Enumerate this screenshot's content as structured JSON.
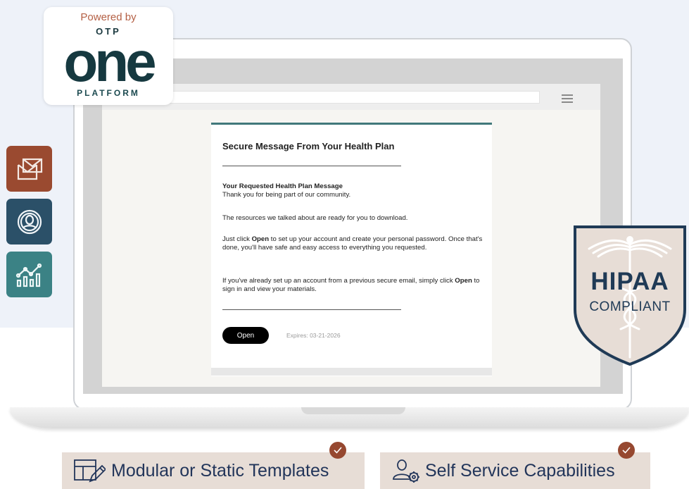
{
  "logo": {
    "powered_by": "Powered by",
    "brand_top": "OTP",
    "brand_main": "one",
    "brand_bottom": "PLATFORM",
    "colors": {
      "accent": "#b46045",
      "dark": "#163940"
    }
  },
  "side_icons": [
    {
      "name": "envelope-icon",
      "color": "#9a4a30"
    },
    {
      "name": "user-circle-icon",
      "color": "#2b5068"
    },
    {
      "name": "analytics-chart-icon",
      "color": "#3b8285"
    }
  ],
  "browser": {
    "menu_icon": "hamburger-icon"
  },
  "email": {
    "title": "Secure Message From Your Health Plan",
    "heading": "Your Requested Health Plan Message",
    "intro": "Thank you for being part of our community.",
    "resources": "The resources we talked about are ready for you to download.",
    "p3_before": "Just click ",
    "p3_bold": "Open",
    "p3_after": " to set up your account and create your personal password. Once that's done, you'll have safe and easy access to everything you requested.",
    "p4_before": "If you've already set up an account from a previous secure email, simply click ",
    "p4_bold": "Open",
    "p4_after": " to sign in and view your materials.",
    "open_label": "Open",
    "expires": "Expires: 03-21-2026",
    "accent_color": "#41787b"
  },
  "badge": {
    "line1": "HIPAA",
    "line2": "COMPLIANT",
    "colors": {
      "border": "#1f3a56",
      "fill": "#e7ddd6"
    }
  },
  "features": [
    {
      "label": "Modular or Static Templates",
      "icon": "template-edit-icon",
      "checked": true
    },
    {
      "label": "Self Service Capabilities",
      "icon": "user-settings-icon",
      "checked": true
    }
  ],
  "colors": {
    "check": "#964830",
    "chip": "#e7ddd6",
    "chip_text": "#22355a"
  }
}
